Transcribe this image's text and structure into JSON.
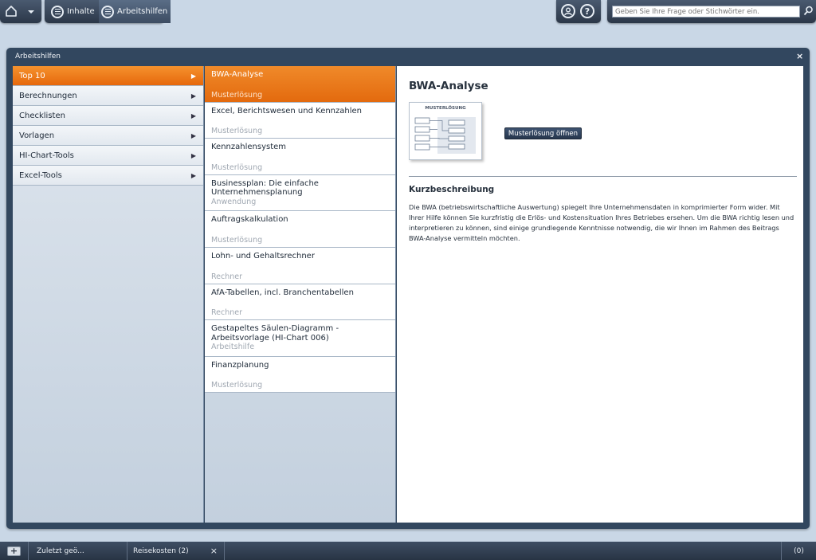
{
  "topbar": {
    "home_icon": "home-icon",
    "nav": [
      {
        "label": "Inhalte",
        "icon": "list-icon"
      },
      {
        "label": "Arbeitshilfen",
        "icon": "list-icon"
      }
    ],
    "search_placeholder": "Geben Sie Ihre Frage oder Stichwörter ein."
  },
  "panel": {
    "title": "Arbeitshilfen",
    "close": "×"
  },
  "categories": [
    {
      "label": "Top 10",
      "active": true
    },
    {
      "label": "Berechnungen"
    },
    {
      "label": "Checklisten"
    },
    {
      "label": "Vorlagen"
    },
    {
      "label": "HI-Chart-Tools"
    },
    {
      "label": "Excel-Tools"
    }
  ],
  "items": [
    {
      "title": "BWA-Analyse",
      "sub": "Musterlösung",
      "active": true
    },
    {
      "title": "Excel, Berichtswesen und Kennzahlen",
      "sub": "Musterlösung"
    },
    {
      "title": "Kennzahlensystem",
      "sub": "Musterlösung"
    },
    {
      "title": "Businessplan: Die einfache Unternehmensplanung",
      "sub": "Anwendung"
    },
    {
      "title": "Auftragskalkulation",
      "sub": "Musterlösung"
    },
    {
      "title": "Lohn- und Gehaltsrechner",
      "sub": "Rechner"
    },
    {
      "title": "AfA-Tabellen, incl. Branchentabellen",
      "sub": "Rechner"
    },
    {
      "title": "Gestapeltes Säulen-Diagramm - Arbeitsvorlage (HI-Chart 006)",
      "sub": "Arbeitshilfe"
    },
    {
      "title": "Finanzplanung",
      "sub": "Musterlösung"
    }
  ],
  "detail": {
    "title": "BWA-Analyse",
    "thumb_label": "MUSTERLÖSUNG",
    "open_button": "Musterlösung öffnen",
    "section_heading": "Kurzbeschreibung",
    "section_text": "Die BWA (betriebswirtschaftliche Auswertung) spiegelt Ihre Unternehmensdaten in komprimierter Form wider. Mit Ihrer Hilfe können Sie kurzfristig die Erlös- und Kostensituation Ihres Betriebes ersehen. Um die BWA richtig lesen und interpretieren zu können, sind einige grundlegende Kenntnisse notwendig, die wir Ihnen im Rahmen des Beitrags BWA-Analyse vermitteln möchten."
  },
  "bottombar": {
    "recent": "Zuletzt geö...",
    "tab": "Reisekosten (2)",
    "tab_close": "×",
    "count": "(0)"
  },
  "colors": {
    "accent": "#e8700f",
    "dark": "#32475f"
  }
}
